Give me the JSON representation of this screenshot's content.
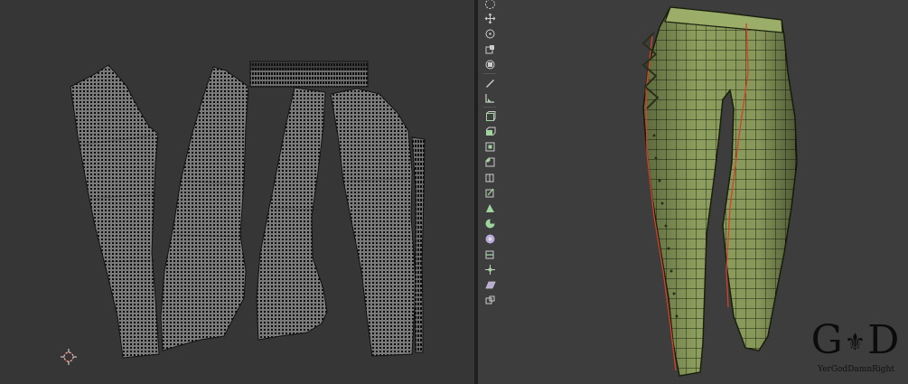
{
  "window": {
    "panels": [
      "uv-editor",
      "3d-viewport"
    ]
  },
  "uv_editor": {
    "islands": [
      "left-leg-front",
      "left-leg-back",
      "right-leg-back",
      "right-leg-front",
      "waistband-strip",
      "side-seam-strip"
    ]
  },
  "toolbar": {
    "tools": [
      {
        "name": "select-tool-icon",
        "active": false
      },
      {
        "name": "move-tool-icon",
        "active": false
      },
      {
        "name": "rotate-tool-icon",
        "active": false
      },
      {
        "name": "scale-tool-icon",
        "active": false
      },
      {
        "name": "transform-tool-icon",
        "active": false
      },
      {
        "name": "annotate-tool-icon",
        "active": false
      },
      {
        "name": "measure-tool-icon",
        "active": false
      },
      {
        "name": "add-cube-tool-icon",
        "active": false
      },
      {
        "name": "extrude-tool-icon",
        "active": false
      },
      {
        "name": "inset-tool-icon",
        "active": false
      },
      {
        "name": "bevel-tool-icon",
        "active": false
      },
      {
        "name": "loop-cut-tool-icon",
        "active": false
      },
      {
        "name": "knife-tool-icon",
        "active": false
      },
      {
        "name": "poly-build-tool-icon",
        "active": false
      },
      {
        "name": "spin-tool-icon",
        "active": false
      },
      {
        "name": "smooth-tool-icon",
        "active": false
      },
      {
        "name": "edge-slide-tool-icon",
        "active": false
      },
      {
        "name": "shrink-fatten-tool-icon",
        "active": false
      },
      {
        "name": "shear-tool-icon",
        "active": false
      },
      {
        "name": "rip-region-tool-icon",
        "active": false
      }
    ]
  },
  "colors": {
    "mesh_fill": "#8a9e5c",
    "mesh_wire": "#1e2412",
    "seam": "#d2412a",
    "uv_vertex": "#101010"
  },
  "watermark": {
    "text": "YerGodDamnRight"
  }
}
